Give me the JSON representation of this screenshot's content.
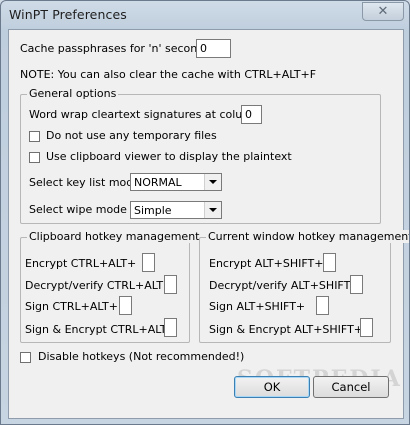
{
  "window": {
    "title": "WinPT Preferences",
    "close_label": "✕"
  },
  "cache": {
    "label": "Cache passphrases for 'n' seconds",
    "value": "0"
  },
  "note": "NOTE: You can also clear the cache with CTRL+ALT+F",
  "general": {
    "legend": "General options",
    "wordwrap_label": "Word wrap cleartext signatures at column",
    "wordwrap_value": "0",
    "no_temp_files_label": "Do not use any temporary files",
    "clipboard_viewer_label": "Use clipboard viewer to display the plaintext",
    "keylist_label": "Select key list mode",
    "keylist_value": "NORMAL",
    "wipe_label": "Select wipe mode",
    "wipe_value": "Simple"
  },
  "clipboard_hotkeys": {
    "legend": "Clipboard hotkey management",
    "items": [
      {
        "label": "Encrypt CTRL+ALT+",
        "value": ""
      },
      {
        "label": "Decrypt/verify CTRL+ALT+",
        "value": ""
      },
      {
        "label": "Sign CTRL+ALT+",
        "value": ""
      },
      {
        "label": "Sign & Encrypt CTRL+ALT+",
        "value": ""
      }
    ]
  },
  "window_hotkeys": {
    "legend": "Current window hotkey management",
    "items": [
      {
        "label": "Encrypt ALT+SHIFT+",
        "value": ""
      },
      {
        "label": "Decrypt/verify ALT+SHIFT+",
        "value": ""
      },
      {
        "label": "Sign ALT+SHIFT+",
        "value": ""
      },
      {
        "label": "Sign & Encrypt ALT+SHIFT+",
        "value": ""
      }
    ]
  },
  "disable_hotkeys_label": "Disable hotkeys (Not recommended!)",
  "buttons": {
    "ok": "OK",
    "cancel": "Cancel"
  },
  "watermark": "SOFTPEDIA"
}
